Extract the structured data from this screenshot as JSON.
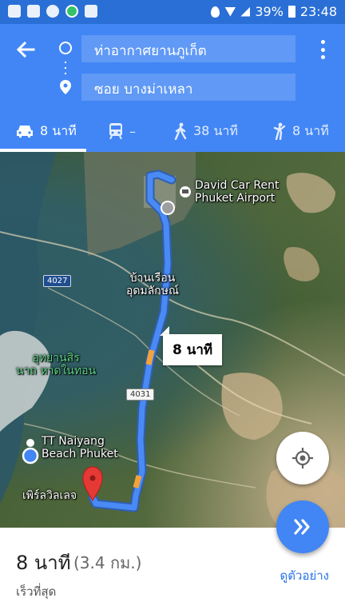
{
  "status_bar": {
    "icons_left": [
      "image-icon",
      "maps-icon",
      "chat-icon",
      "phone-app-icon",
      "youtube-icon"
    ],
    "icons_right": [
      "location-icon",
      "wifi-icon",
      "signal-icon",
      "battery-icon"
    ],
    "battery": "39%",
    "time": "23:48"
  },
  "header": {
    "origin": "ท่าอากาศยานภูเก็ต",
    "destination": "ซอย บางม่าเหลา",
    "modes": [
      {
        "name": "drive",
        "icon": "car-icon",
        "value": "8 นาที",
        "active": true
      },
      {
        "name": "transit",
        "icon": "train-icon",
        "value": "–",
        "active": false
      },
      {
        "name": "walk",
        "icon": "walk-icon",
        "value": "38 นาที",
        "active": false
      },
      {
        "name": "rideshare",
        "icon": "ride-icon",
        "value": "8 นาที",
        "active": false
      }
    ]
  },
  "map": {
    "labels": {
      "car_rent_1": "David Car Rent",
      "car_rent_2": "Phuket Airport",
      "village_1": "บ้านเรือน",
      "village_2": "อุดมลักษณ์",
      "park_1": "อุทยานสิร",
      "park_2": "นาถ หาดในทอน",
      "hotel_1": "TT Naiyang",
      "hotel_2": "Beach Phuket",
      "destination": "เพิร์ลวิลเลจ"
    },
    "road_badges": {
      "road_1": "4027",
      "road_2": "4031"
    },
    "route_time": "8 นาที",
    "colors": {
      "route": "#4a8af4",
      "traffic": "#f4a23a",
      "pin": "#e53935"
    }
  },
  "summary": {
    "duration": "8 นาที",
    "distance": "(3.4 กม.)",
    "subtitle": "เร็วที่สุด",
    "preview": "ดูตัวอย่าง"
  }
}
